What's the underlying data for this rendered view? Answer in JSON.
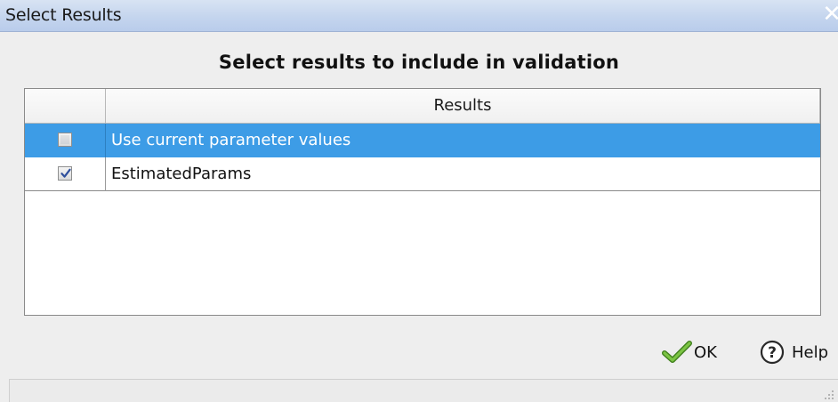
{
  "window": {
    "title": "Select Results",
    "close_label": "✕"
  },
  "heading": "Select results to include in validation",
  "table": {
    "column_header": "Results",
    "rows": [
      {
        "label": "Use current parameter values",
        "checked": false,
        "selected": true
      },
      {
        "label": "EstimatedParams",
        "checked": true,
        "selected": false
      }
    ]
  },
  "buttons": {
    "ok_label": "OK",
    "ok_icon": "checkmark-icon",
    "help_label": "Help",
    "help_icon": "question-circle-icon"
  },
  "colors": {
    "selection": "#3d9ce6",
    "titlebar": "#c4d5ee",
    "ok_icon": "#5aa02c",
    "help_icon": "#2a2a2a"
  }
}
